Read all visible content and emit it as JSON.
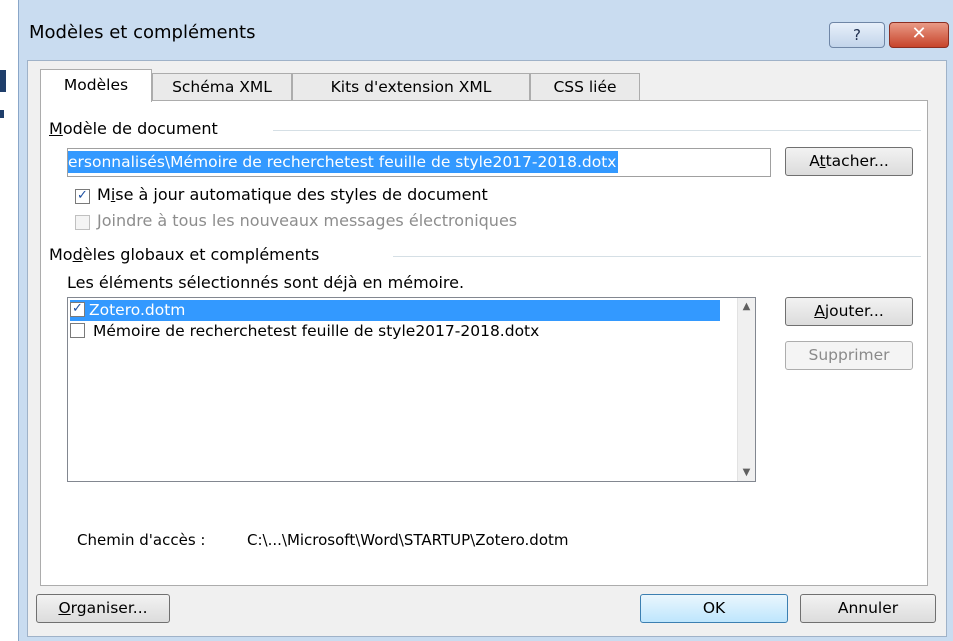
{
  "window": {
    "title": "Modèles et compléments",
    "help_label": "?",
    "close_label": "✕"
  },
  "tabs": [
    {
      "label": "Modèles",
      "active": true
    },
    {
      "label": "Schéma XML",
      "active": false
    },
    {
      "label": "Kits d'extension XML",
      "active": false
    },
    {
      "label": "CSS liée",
      "active": false
    }
  ],
  "document_template": {
    "group_label_mnemonic": "M",
    "group_label_rest": "odèle de document",
    "path_value": "ersonnalisés\\Mémoire de recherchetest feuille de style2017-2018.dotx",
    "attach_button_pre": "A",
    "attach_button_mnemonic": "t",
    "attach_button_post": "tacher...",
    "auto_update": {
      "pre": "M",
      "mnemonic": "i",
      "post": "se à jour automatique des styles de document",
      "checked": true
    },
    "attach_to_emails": {
      "label": "Joindre à tous les nouveaux messages électroniques",
      "checked": false,
      "disabled": true
    }
  },
  "global_templates": {
    "group_label_pre": "Mo",
    "group_label_mnemonic": "d",
    "group_label_post": "èles globaux et compléments",
    "info_text": "Les éléments sélectionnés sont déjà en mémoire.",
    "items": [
      {
        "label": "Zotero.dotm",
        "checked": true,
        "selected": true
      },
      {
        "label": "Mémoire de recherchetest feuille de style2017-2018.dotx",
        "checked": false,
        "selected": false
      }
    ],
    "add_button_mnemonic": "A",
    "add_button_rest": "jouter...",
    "remove_button": "Supprimer",
    "path_label": "Chemin d'accès :",
    "path_value": "C:\\...\\Microsoft\\Word\\STARTUP\\Zotero.dotm"
  },
  "footer": {
    "organizer_mnemonic": "O",
    "organizer_rest": "rganiser...",
    "ok": "OK",
    "cancel": "Annuler"
  },
  "colors": {
    "selection": "#3399ff",
    "window_frame": "#c9dcf0",
    "close_button": "#c7442b"
  }
}
